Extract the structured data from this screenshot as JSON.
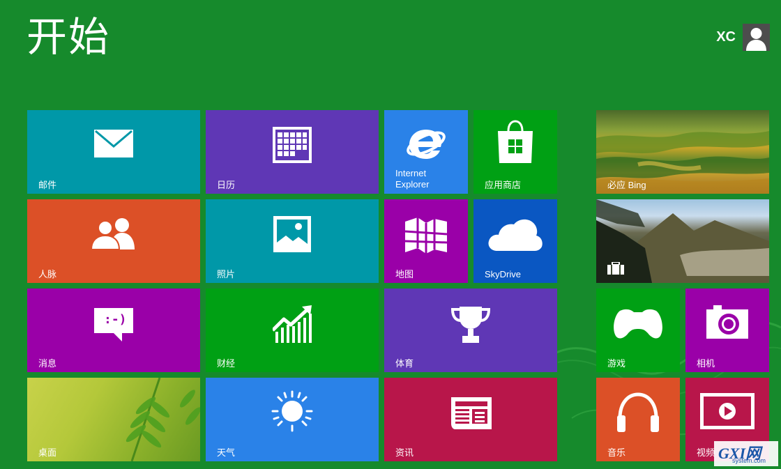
{
  "start_title": "开始",
  "user": {
    "name": "XC",
    "avatar_icon": "user-silhouette-icon"
  },
  "background_color": "#168a2c",
  "tiles": {
    "mail": {
      "label": "邮件",
      "color": "#0098a8",
      "icon": "envelope-icon"
    },
    "calendar": {
      "label": "日历",
      "color": "#5f37b5",
      "icon": "calendar-icon"
    },
    "ie": {
      "label_line1": "Internet",
      "label_line2": "Explorer",
      "color": "#2a82e8",
      "icon": "internet-explorer-icon"
    },
    "store": {
      "label": "应用商店",
      "color": "#00a014",
      "icon": "store-bag-icon"
    },
    "bing": {
      "label": "必应 Bing",
      "icon": "bing-landscape-photo"
    },
    "people": {
      "label": "人脉",
      "color": "#dc5027",
      "icon": "people-icon"
    },
    "photos": {
      "label": "照片",
      "color": "#0098a8",
      "icon": "photo-icon"
    },
    "maps": {
      "label": "地图",
      "color": "#9a00a8",
      "icon": "map-icon"
    },
    "skydrive": {
      "label": "SkyDrive",
      "color": "#0a57c2",
      "icon": "cloud-icon"
    },
    "travel": {
      "label": "",
      "icon": "suitcase-icon"
    },
    "messaging": {
      "label": "消息",
      "color": "#9a00a8",
      "icon": "speech-bubble-icon",
      "emoticon": ":-)"
    },
    "finance": {
      "label": "财经",
      "color": "#00a014",
      "icon": "stock-chart-icon"
    },
    "sports": {
      "label": "体育",
      "color": "#5f37b5",
      "icon": "trophy-icon"
    },
    "games": {
      "label": "游戏",
      "color": "#00a014",
      "icon": "game-controller-icon"
    },
    "camera": {
      "label": "相机",
      "color": "#9a00a8",
      "icon": "camera-icon"
    },
    "desktop": {
      "label": "桌面",
      "icon": "desktop-leaf-wallpaper"
    },
    "weather": {
      "label": "天气",
      "color": "#2a82e8",
      "icon": "sun-icon"
    },
    "news": {
      "label": "资讯",
      "color": "#b8164a",
      "icon": "newspaper-icon"
    },
    "music": {
      "label": "音乐",
      "color": "#dc5027",
      "icon": "headphones-icon"
    },
    "video": {
      "label": "视频",
      "color": "#b8164a",
      "icon": "video-play-icon"
    }
  },
  "watermark": {
    "logo_text": "GXI网",
    "site": "system.com"
  }
}
